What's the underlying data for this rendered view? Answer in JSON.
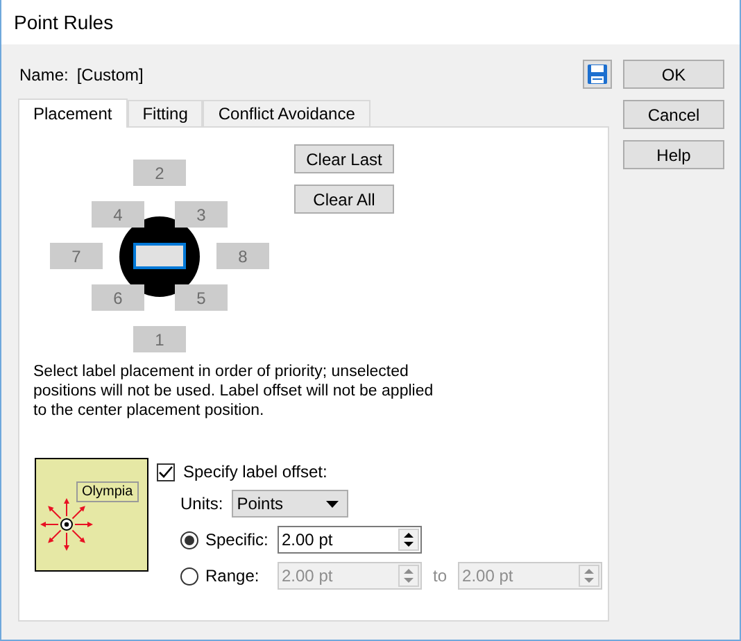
{
  "window": {
    "title": "Point Rules"
  },
  "name": {
    "label": "Name:",
    "value": "[Custom]"
  },
  "buttons": [
    {
      "label": "OK"
    },
    {
      "label": "Cancel"
    },
    {
      "label": "Help"
    }
  ],
  "tabs": [
    {
      "label": "Placement",
      "selected": true
    },
    {
      "label": "Fitting",
      "selected": false
    },
    {
      "label": "Conflict Avoidance",
      "selected": false
    }
  ],
  "placement": {
    "clear_buttons": [
      "Clear Last",
      "Clear All"
    ],
    "positions": [
      {
        "label": "2"
      },
      {
        "label": "4"
      },
      {
        "label": "3"
      },
      {
        "label": "7"
      },
      {
        "label": "8"
      },
      {
        "label": "6"
      },
      {
        "label": "5"
      },
      {
        "label": "1"
      }
    ],
    "center": {
      "focused": true
    },
    "description": "Select label placement in order of priority; unselected positions will not be used. Label offset will not be applied to the center placement position."
  },
  "offset": {
    "preview_label": "Olympia",
    "specify": {
      "label": "Specify label offset:",
      "checked": true
    },
    "units": {
      "label": "Units:",
      "value": "Points"
    },
    "modes": [
      {
        "kind": "single",
        "label": "Specific:",
        "selected": true,
        "value": "2.00 pt"
      },
      {
        "kind": "range",
        "label": "Range:",
        "selected": false,
        "from": "2.00 pt",
        "separator": "to",
        "to": "2.00 pt"
      }
    ]
  }
}
